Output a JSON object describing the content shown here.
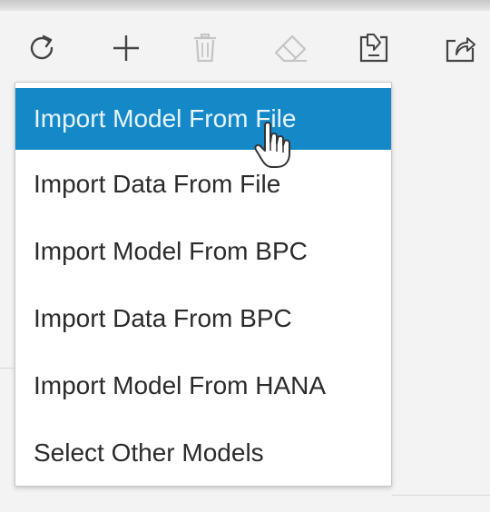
{
  "toolbar": {
    "buttons": [
      {
        "icon": "refresh-icon",
        "enabled": true
      },
      {
        "icon": "plus-icon",
        "enabled": true
      },
      {
        "icon": "trash-icon",
        "enabled": false
      },
      {
        "icon": "eraser-icon",
        "enabled": false
      },
      {
        "icon": "import-icon",
        "enabled": true
      },
      {
        "icon": "export-icon",
        "enabled": true
      }
    ]
  },
  "menu": {
    "items": [
      {
        "label": "Import Model From File",
        "selected": true
      },
      {
        "label": "Import Data From File",
        "selected": false
      },
      {
        "label": "Import Model From BPC",
        "selected": false
      },
      {
        "label": "Import Data From BPC",
        "selected": false
      },
      {
        "label": "Import Model From HANA",
        "selected": false
      },
      {
        "label": "Select Other Models",
        "selected": false
      }
    ]
  },
  "colors": {
    "selected_background": "#1589c8",
    "selected_text": "#e8f4fb",
    "icon_enabled": "#444444",
    "icon_disabled": "#c4c4c4"
  }
}
